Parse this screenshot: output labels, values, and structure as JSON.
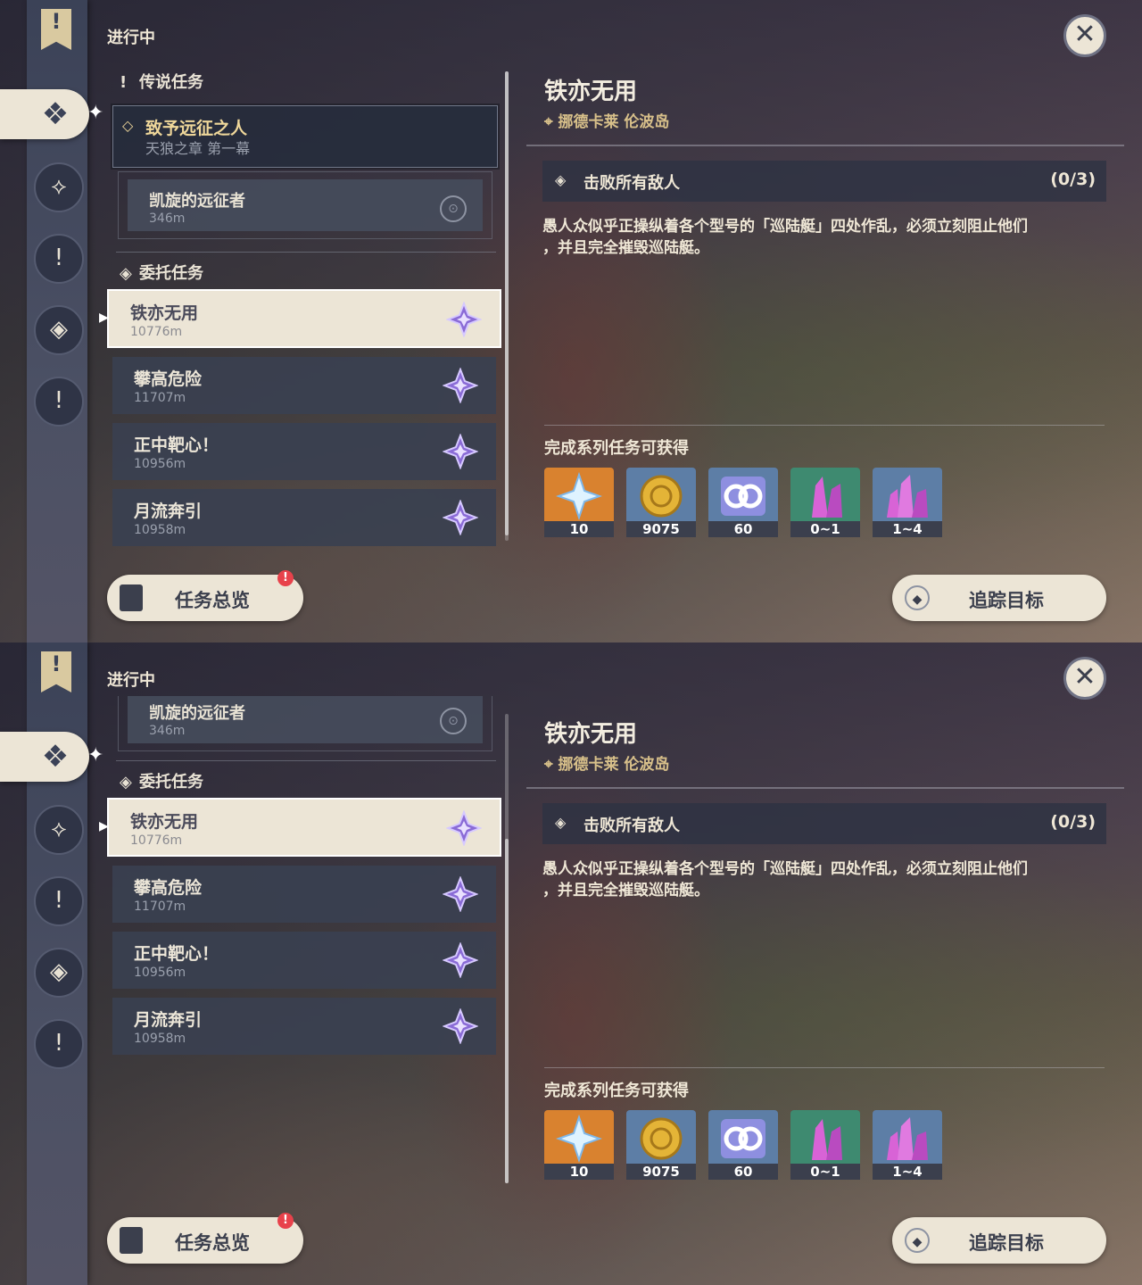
{
  "header": {
    "label": "进行中"
  },
  "close_icon": "close-icon",
  "categories": {
    "legend": "传说任务",
    "commission": "委托任务"
  },
  "legend_quest": {
    "title": "致予远征之人",
    "subtitle": "天狼之章 第一幕"
  },
  "legend_subquest": {
    "title": "凯旋的远征者",
    "distance": "346m"
  },
  "quests": [
    {
      "title": "铁亦无用",
      "distance": "10776m"
    },
    {
      "title": "攀高危险",
      "distance": "11707m"
    },
    {
      "title": "正中靶心！",
      "distance": "10956m"
    },
    {
      "title": "月流奔引",
      "distance": "10958m"
    }
  ],
  "detail": {
    "title": "铁亦无用",
    "location": "挪德卡莱 伦波岛",
    "objective": "击败所有敌人",
    "progress": "(0/3)",
    "description_1": "愚人众似乎正操纵着各个型号的「巡陆艇」四处作乱，必须立刻阻止他们",
    "description_2": "，并且完全摧毁巡陆艇。"
  },
  "rewards_title": "完成系列任务可获得",
  "rewards": [
    {
      "qty": "10",
      "icon": "primogem-icon",
      "color": "#d9822f"
    },
    {
      "qty": "9075",
      "icon": "mora-icon",
      "color": "#5d7ea6"
    },
    {
      "qty": "60",
      "icon": "adventure-exp-icon",
      "color": "#5d7ea6"
    },
    {
      "qty": "0~1",
      "icon": "crystal-chunk-icon",
      "color": "#3e8a70"
    },
    {
      "qty": "1~4",
      "icon": "crystal-cluster-icon",
      "color": "#5d7ea6"
    }
  ],
  "buttons": {
    "overview": "任务总览",
    "overview_badge": "!",
    "track": "追踪目标"
  },
  "colors": {
    "accent": "#ece5d6",
    "legend_gold": "#efd79a",
    "star_purple": "#8a6bd6"
  }
}
